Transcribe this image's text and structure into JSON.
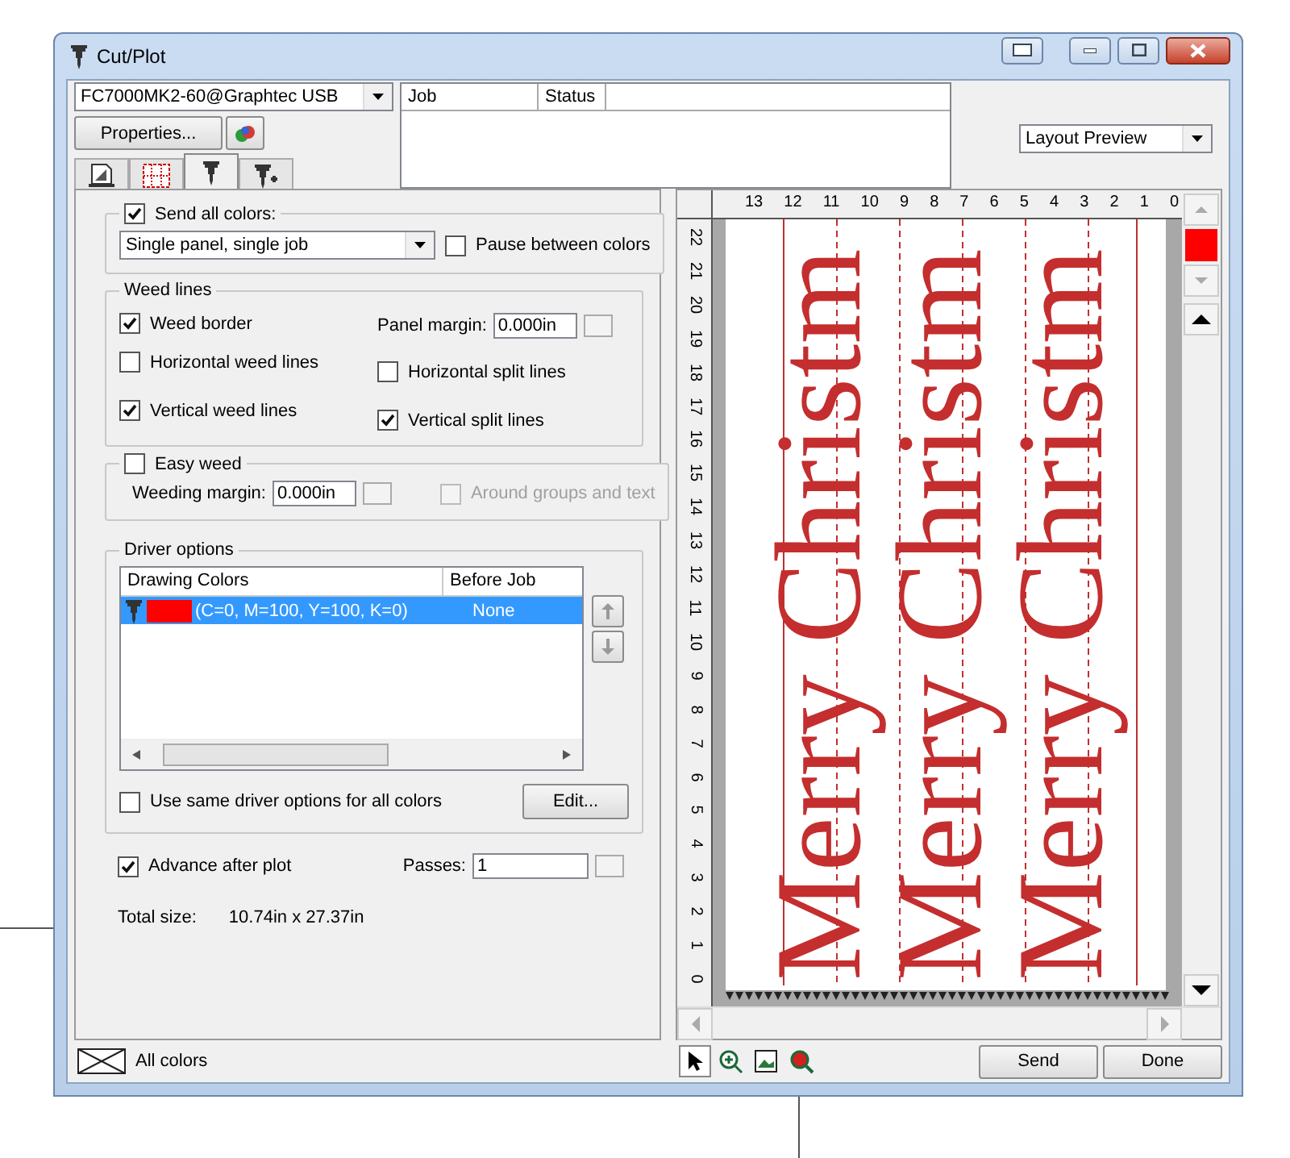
{
  "window": {
    "title": "Cut/Plot"
  },
  "device": {
    "value": "FC7000MK2-60@Graphtec USB"
  },
  "properties_button": "Properties...",
  "tabs": [
    {
      "kind": "page",
      "selected": false
    },
    {
      "kind": "grid",
      "selected": false
    },
    {
      "kind": "cutter",
      "selected": true
    },
    {
      "kind": "cutter-plus",
      "selected": false
    }
  ],
  "job_table": {
    "columns": [
      "Job",
      "Status"
    ]
  },
  "view_select": {
    "value": "Layout Preview"
  },
  "send_all_colors": {
    "label": "Send all colors:",
    "checked": true
  },
  "panel_mode": {
    "value": "Single panel, single job"
  },
  "pause_between_colors": {
    "label": "Pause between colors",
    "checked": false
  },
  "weed_lines": {
    "title": "Weed lines",
    "options": [
      {
        "label": "Weed border",
        "checked": true
      },
      {
        "label": "Horizontal weed lines",
        "checked": false
      },
      {
        "label": "Horizontal split lines",
        "checked": false
      },
      {
        "label": "Vertical weed lines",
        "checked": true
      },
      {
        "label": "Vertical split lines",
        "checked": true
      }
    ],
    "panel_margin": {
      "label": "Panel margin:",
      "value": "0.000in"
    }
  },
  "easy_weed": {
    "label": "Easy weed",
    "checked": false,
    "margin_label": "Weeding margin:",
    "margin_value": "0.000in",
    "around": {
      "label": "Around groups and text",
      "checked": false,
      "disabled": true
    }
  },
  "driver_options": {
    "title": "Driver options",
    "columns": [
      "Drawing Colors",
      "Before Job"
    ],
    "rows": [
      {
        "color": "#ff0000",
        "description": "(C=0, M=100, Y=100, K=0)",
        "before_job": "None",
        "selected": true
      }
    ],
    "same_for_all": {
      "label": "Use same driver options for all colors",
      "checked": false
    },
    "edit_button": "Edit..."
  },
  "advance_after_plot": {
    "label": "Advance after plot",
    "checked": true
  },
  "passes": {
    "label": "Passes:",
    "value": "1"
  },
  "total_size": {
    "label": "Total size:",
    "value": "10.74in x 27.37in"
  },
  "preview": {
    "x_ruler": [
      "13",
      "12",
      "11",
      "10",
      "9",
      "8",
      "7",
      "6",
      "5",
      "4",
      "3",
      "2",
      "1",
      "0"
    ],
    "y_ruler": [
      "22",
      "21",
      "20",
      "19",
      "18",
      "17",
      "16",
      "15",
      "14",
      "13",
      "12",
      "11",
      "10",
      "9",
      "8",
      "7",
      "6",
      "5",
      "4",
      "3",
      "2",
      "1",
      "0"
    ],
    "panels": [
      {
        "text": "Merry Christm"
      },
      {
        "text": "Merry Christm"
      },
      {
        "text": "Merry Christm"
      }
    ],
    "color_swatch": {
      "color": "#ff0000"
    }
  },
  "status": {
    "label": "All colors"
  },
  "buttons": [
    "Send",
    "Done"
  ]
}
